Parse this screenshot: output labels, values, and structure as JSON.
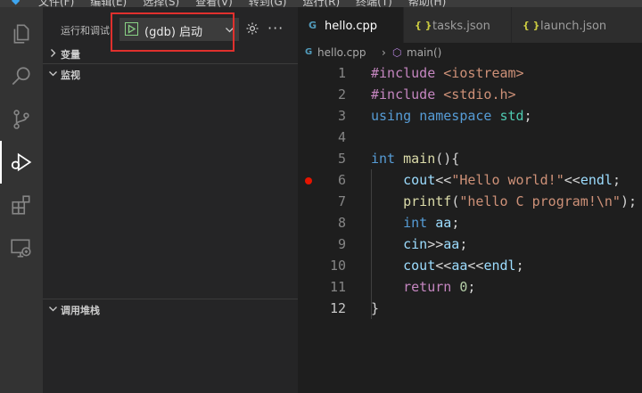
{
  "menubar": {
    "items": [
      "文件(F)",
      "编辑(E)",
      "选择(S)",
      "查看(V)",
      "转到(G)",
      "运行(R)",
      "终端(T)",
      "帮助(H)"
    ]
  },
  "activity_bar": {
    "items": [
      "explorer",
      "search",
      "source-control",
      "run-and-debug",
      "extensions",
      "remote-explorer"
    ],
    "active": "run-and-debug"
  },
  "sidebar": {
    "title": "运行和调试",
    "config_name": "(gdb) 启动",
    "sections": {
      "variables": "变量",
      "watch": "监视",
      "call_stack": "调用堆栈"
    }
  },
  "editor": {
    "tabs": [
      {
        "icon": "G",
        "label": "hello.cpp",
        "active": true
      },
      {
        "icon": "{ }",
        "label": "tasks.json",
        "active": false
      },
      {
        "icon": "{ }",
        "label": "launch.json",
        "active": false
      }
    ],
    "breadcrumb": {
      "file": "hello.cpp",
      "symbol": "main()"
    },
    "line_numbers": [
      "1",
      "2",
      "3",
      "4",
      "5",
      "6",
      "7",
      "8",
      "9",
      "10",
      "11",
      "12"
    ],
    "current_line": 12,
    "breakpoint_line": 6,
    "code_lines": [
      "#include <iostream>",
      "#include <stdio.h>",
      "using namespace std;",
      "",
      "int main(){",
      "    cout<<\"Hello world!\"<<endl;",
      "    printf(\"hello C program!\\n\");",
      "    int aa;",
      "    cin>>aa;",
      "    cout<<aa<<endl;",
      "    return 0;",
      "}"
    ]
  },
  "colors": {
    "accent": "#3ea6f0",
    "highlight_box": "#e0302d",
    "breakpoint": "#e51400",
    "play_green": "#89d185"
  }
}
